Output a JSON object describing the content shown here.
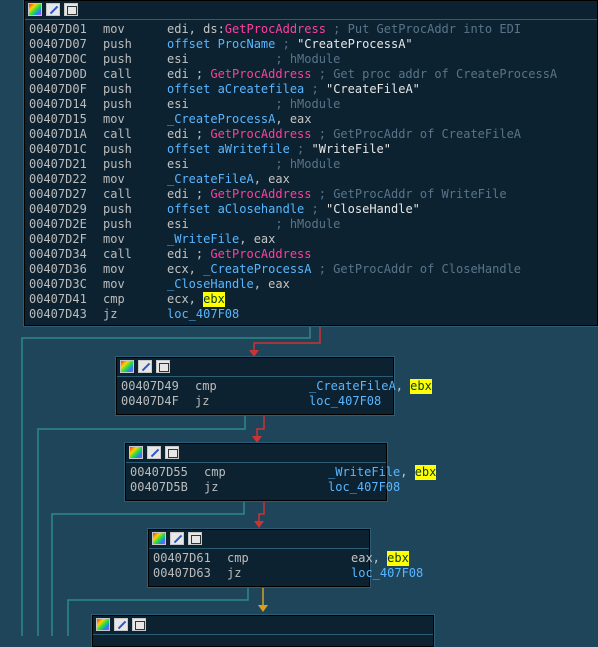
{
  "blocks": [
    {
      "rows": [
        {
          "addr": "00407D01",
          "mnem": "mov",
          "ops": [
            {
              "t": "edi, ds:",
              "c": "plain"
            },
            {
              "t": "GetProcAddress",
              "c": "fn"
            },
            {
              "t": " ; Put GetProcAddr into EDI",
              "c": "cm"
            }
          ]
        },
        {
          "addr": "00407D07",
          "mnem": "push",
          "ops": [
            {
              "t": "offset ProcName",
              "c": "nm"
            },
            {
              "t": " ; ",
              "c": "cm"
            },
            {
              "t": "\"CreateProcessA\"",
              "c": "str"
            }
          ]
        },
        {
          "addr": "00407D0C",
          "mnem": "push",
          "ops": [
            {
              "t": "esi",
              "c": "plain"
            },
            {
              "t": "            ; hModule",
              "c": "cm"
            }
          ]
        },
        {
          "addr": "00407D0D",
          "mnem": "call",
          "ops": [
            {
              "t": "edi ; ",
              "c": "plain"
            },
            {
              "t": "GetProcAddress",
              "c": "fn"
            },
            {
              "t": " ; Get proc addr of CreateProcessA",
              "c": "cm"
            }
          ]
        },
        {
          "addr": "00407D0F",
          "mnem": "push",
          "ops": [
            {
              "t": "offset aCreatefilea",
              "c": "nm"
            },
            {
              "t": " ; ",
              "c": "cm"
            },
            {
              "t": "\"CreateFileA\"",
              "c": "str"
            }
          ]
        },
        {
          "addr": "00407D14",
          "mnem": "push",
          "ops": [
            {
              "t": "esi",
              "c": "plain"
            },
            {
              "t": "            ; hModule",
              "c": "cm"
            }
          ]
        },
        {
          "addr": "00407D15",
          "mnem": "mov",
          "ops": [
            {
              "t": "_CreateProcessA",
              "c": "nm"
            },
            {
              "t": ", eax",
              "c": "plain"
            }
          ]
        },
        {
          "addr": "00407D1A",
          "mnem": "call",
          "ops": [
            {
              "t": "edi ; ",
              "c": "plain"
            },
            {
              "t": "GetProcAddress",
              "c": "fn"
            },
            {
              "t": " ; GetProcAddr of CreateFileA",
              "c": "cm"
            }
          ]
        },
        {
          "addr": "00407D1C",
          "mnem": "push",
          "ops": [
            {
              "t": "offset aWritefile",
              "c": "nm"
            },
            {
              "t": " ; ",
              "c": "cm"
            },
            {
              "t": "\"WriteFile\"",
              "c": "str"
            }
          ]
        },
        {
          "addr": "00407D21",
          "mnem": "push",
          "ops": [
            {
              "t": "esi",
              "c": "plain"
            },
            {
              "t": "            ; hModule",
              "c": "cm"
            }
          ]
        },
        {
          "addr": "00407D22",
          "mnem": "mov",
          "ops": [
            {
              "t": "_CreateFileA",
              "c": "nm"
            },
            {
              "t": ", eax",
              "c": "plain"
            }
          ]
        },
        {
          "addr": "00407D27",
          "mnem": "call",
          "ops": [
            {
              "t": "edi ; ",
              "c": "plain"
            },
            {
              "t": "GetProcAddress",
              "c": "fn"
            },
            {
              "t": " ; GetProcAddr of WriteFile",
              "c": "cm"
            }
          ]
        },
        {
          "addr": "00407D29",
          "mnem": "push",
          "ops": [
            {
              "t": "offset aClosehandle",
              "c": "nm"
            },
            {
              "t": " ; ",
              "c": "cm"
            },
            {
              "t": "\"CloseHandle\"",
              "c": "str"
            }
          ]
        },
        {
          "addr": "00407D2E",
          "mnem": "push",
          "ops": [
            {
              "t": "esi",
              "c": "plain"
            },
            {
              "t": "            ; hModule",
              "c": "cm"
            }
          ]
        },
        {
          "addr": "00407D2F",
          "mnem": "mov",
          "ops": [
            {
              "t": "_WriteFile",
              "c": "nm"
            },
            {
              "t": ", eax",
              "c": "plain"
            }
          ]
        },
        {
          "addr": "00407D34",
          "mnem": "call",
          "ops": [
            {
              "t": "edi ; ",
              "c": "plain"
            },
            {
              "t": "GetProcAddress",
              "c": "fn"
            }
          ]
        },
        {
          "addr": "00407D36",
          "mnem": "mov",
          "ops": [
            {
              "t": "ecx, ",
              "c": "plain"
            },
            {
              "t": "_CreateProcessA",
              "c": "nm"
            },
            {
              "t": " ; GetProcAddr of CloseHandle",
              "c": "cm"
            }
          ]
        },
        {
          "addr": "00407D3C",
          "mnem": "mov",
          "ops": [
            {
              "t": "_CloseHandle",
              "c": "nm"
            },
            {
              "t": ", eax",
              "c": "plain"
            }
          ]
        },
        {
          "addr": "00407D41",
          "mnem": "cmp",
          "ops": [
            {
              "t": "ecx, ",
              "c": "plain"
            },
            {
              "t": "ebx",
              "c": "hl"
            }
          ]
        },
        {
          "addr": "00407D43",
          "mnem": "jz",
          "ops": [
            {
              "t": "loc_407F08",
              "c": "nm"
            }
          ]
        }
      ]
    },
    {
      "rows": [
        {
          "addr": "00407D49",
          "mnem": "cmp",
          "ops": [
            {
              "t": "_CreateFileA",
              "c": "nm"
            },
            {
              "t": ", ",
              "c": "plain"
            },
            {
              "t": "ebx",
              "c": "hl"
            }
          ]
        },
        {
          "addr": "00407D4F",
          "mnem": "jz",
          "ops": [
            {
              "t": "loc_407F08",
              "c": "nm"
            }
          ]
        }
      ]
    },
    {
      "rows": [
        {
          "addr": "00407D55",
          "mnem": "cmp",
          "ops": [
            {
              "t": "_WriteFile",
              "c": "nm"
            },
            {
              "t": ", ",
              "c": "plain"
            },
            {
              "t": "ebx",
              "c": "hl"
            }
          ]
        },
        {
          "addr": "00407D5B",
          "mnem": "jz",
          "ops": [
            {
              "t": "loc_407F08",
              "c": "nm"
            }
          ]
        }
      ]
    },
    {
      "rows": [
        {
          "addr": "00407D61",
          "mnem": "cmp",
          "ops": [
            {
              "t": "eax, ",
              "c": "plain"
            },
            {
              "t": "ebx",
              "c": "hl"
            }
          ]
        },
        {
          "addr": "00407D63",
          "mnem": "jz",
          "ops": [
            {
              "t": "loc_407F08",
              "c": "nm"
            }
          ]
        }
      ]
    },
    {
      "rows": []
    }
  ],
  "colors": {
    "background": "#1f455a",
    "node_bg": "#0c2230",
    "edge_false": "#cc3333",
    "edge_true": "#2c8a8a",
    "edge_unconditional": "#d6a020",
    "highlight": "#ffff00"
  }
}
